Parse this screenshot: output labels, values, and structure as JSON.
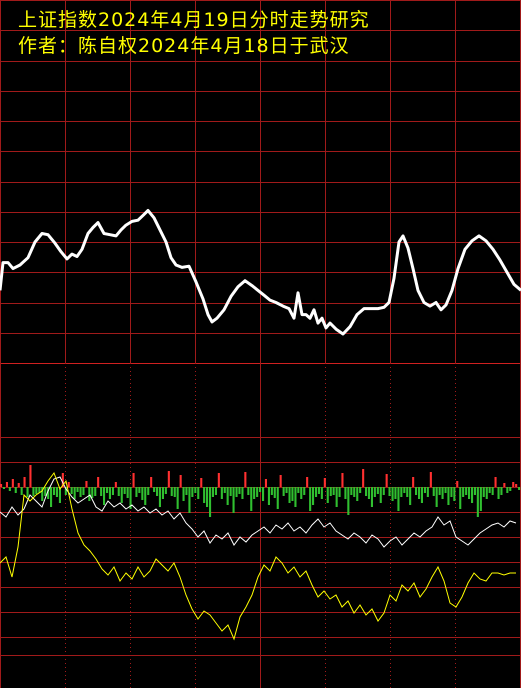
{
  "header": {
    "title": "上证指数2024年4月19日分时走势研究",
    "author": "作者：陈自权2024年4月18日于武汉"
  },
  "colors": {
    "background": "#000000",
    "grid": "#a01a1a",
    "title": "#ffff00",
    "price_line": "#ffffff",
    "bar_up": "#ff3030",
    "bar_down": "#30c030",
    "white_line": "#ffffff",
    "yellow_line": "#ffff00"
  },
  "chart_data": [
    {
      "type": "line",
      "panel": "upper",
      "grid": true,
      "x": [
        0,
        3,
        8,
        13,
        20,
        28,
        35,
        42,
        48,
        55,
        61,
        67,
        72,
        77,
        82,
        88,
        93,
        98,
        104,
        110,
        116,
        121,
        126,
        132,
        138,
        143,
        148,
        154,
        160,
        166,
        171,
        176,
        182,
        189,
        196,
        203,
        208,
        212,
        217,
        224,
        231,
        238,
        245,
        252,
        258,
        264,
        270,
        276,
        283,
        289,
        294,
        298,
        302,
        306,
        310,
        314,
        318,
        322,
        326,
        330,
        336,
        343,
        350,
        357,
        364,
        371,
        378,
        384,
        389,
        394,
        399,
        403,
        408,
        413,
        418,
        424,
        430,
        436,
        441,
        446,
        452,
        458,
        465,
        472,
        479,
        486,
        493,
        500,
        507,
        514,
        521
      ],
      "y": [
        0.1,
        0.33,
        0.33,
        0.28,
        0.31,
        0.37,
        0.5,
        0.57,
        0.56,
        0.49,
        0.42,
        0.36,
        0.4,
        0.38,
        0.44,
        0.57,
        0.62,
        0.66,
        0.57,
        0.56,
        0.55,
        0.6,
        0.64,
        0.67,
        0.68,
        0.72,
        0.76,
        0.7,
        0.6,
        0.5,
        0.37,
        0.31,
        0.29,
        0.3,
        0.17,
        0.03,
        -0.1,
        -0.16,
        -0.13,
        -0.06,
        0.05,
        0.13,
        0.18,
        0.14,
        0.1,
        0.06,
        0.02,
        0.0,
        -0.03,
        -0.05,
        -0.13,
        0.08,
        -0.1,
        -0.1,
        -0.13,
        -0.06,
        -0.17,
        -0.13,
        -0.21,
        -0.17,
        -0.22,
        -0.26,
        -0.2,
        -0.1,
        -0.05,
        -0.05,
        -0.05,
        -0.04,
        0.0,
        0.2,
        0.5,
        0.55,
        0.45,
        0.28,
        0.1,
        0.0,
        -0.03,
        0.0,
        -0.06,
        -0.02,
        0.1,
        0.28,
        0.44,
        0.51,
        0.55,
        0.51,
        0.44,
        0.35,
        0.25,
        0.15,
        0.1
      ],
      "ylim": [
        -0.5,
        2.5
      ]
    },
    {
      "type": "bar",
      "panel": "lower",
      "bars": [
        3,
        -2,
        5,
        -4,
        8,
        -6,
        4,
        -8,
        10,
        -10,
        22,
        -9,
        -7,
        -6,
        -14,
        -9,
        -12,
        -20,
        -8,
        -10,
        -16,
        14,
        -8,
        5,
        -7,
        -12,
        -5,
        -10,
        -8,
        6,
        -14,
        -11,
        -9,
        10,
        -9,
        -18,
        -6,
        -12,
        -8,
        5,
        -9,
        -16,
        -7,
        -11,
        -22,
        14,
        -10,
        -6,
        -13,
        -18,
        -8,
        10,
        -5,
        -9,
        -20,
        -12,
        -7,
        16,
        -9,
        -10,
        -22,
        12,
        -14,
        -8,
        -26,
        -10,
        -6,
        -12,
        9,
        -16,
        -20,
        -30,
        -10,
        -8,
        14,
        -12,
        -6,
        -18,
        -9,
        -26,
        -10,
        -7,
        -12,
        15,
        -8,
        -24,
        -12,
        -10,
        -5,
        -14,
        8,
        -18,
        -8,
        -11,
        -22,
        12,
        -9,
        -6,
        -16,
        -14,
        -20,
        -6,
        -12,
        -8,
        10,
        -24,
        -18,
        -10,
        -7,
        -12,
        9,
        -16,
        -9,
        -8,
        -20,
        -10,
        14,
        -12,
        -28,
        -8,
        -10,
        -14,
        -6,
        18,
        -9,
        -12,
        -20,
        -10,
        -7,
        -16,
        -8,
        13,
        -9,
        -14,
        -12,
        -24,
        -10,
        -6,
        -10,
        -18,
        10,
        -8,
        -12,
        -16,
        -6,
        -10,
        15,
        -9,
        -20,
        -8,
        -12,
        -6,
        -18,
        -10,
        -14,
        6,
        -22,
        -10,
        -8,
        -12,
        -16,
        -8,
        -30,
        -24,
        -10,
        -12,
        -6,
        -8,
        10,
        -12,
        -8,
        4,
        -6,
        -4,
        5,
        3,
        -3
      ],
      "ylim": [
        -40,
        30
      ]
    },
    {
      "type": "line",
      "panel": "lower",
      "series": [
        {
          "color": "white",
          "x": [
            0,
            6,
            12,
            18,
            24,
            30,
            36,
            42,
            48,
            54,
            60,
            66,
            72,
            78,
            84,
            90,
            96,
            102,
            108,
            114,
            120,
            126,
            132,
            138,
            144,
            150,
            156,
            162,
            168,
            174,
            180,
            186,
            192,
            198,
            204,
            210,
            216,
            222,
            228,
            234,
            240,
            246,
            252,
            258,
            264,
            270,
            276,
            282,
            288,
            294,
            300,
            306,
            312,
            318,
            324,
            330,
            336,
            342,
            348,
            354,
            360,
            366,
            372,
            378,
            384,
            390,
            396,
            402,
            408,
            414,
            420,
            426,
            432,
            438,
            444,
            450,
            456,
            462,
            468,
            474,
            480,
            486,
            492,
            498,
            504,
            510,
            516
          ],
          "y": [
            -25,
            -30,
            -20,
            -28,
            -22,
            -8,
            -14,
            -20,
            -4,
            8,
            10,
            -2,
            -10,
            -16,
            -12,
            -8,
            -20,
            -24,
            -14,
            -20,
            -16,
            -22,
            -18,
            -24,
            -20,
            -26,
            -22,
            -28,
            -24,
            -32,
            -26,
            -36,
            -42,
            -50,
            -44,
            -56,
            -48,
            -52,
            -46,
            -58,
            -50,
            -55,
            -48,
            -44,
            -40,
            -46,
            -38,
            -42,
            -36,
            -44,
            -40,
            -46,
            -38,
            -32,
            -40,
            -36,
            -44,
            -48,
            -52,
            -46,
            -50,
            -56,
            -48,
            -52,
            -60,
            -54,
            -50,
            -58,
            -52,
            -46,
            -50,
            -44,
            -40,
            -30,
            -38,
            -34,
            -50,
            -54,
            -58,
            -52,
            -46,
            -42,
            -38,
            -36,
            -40,
            -34,
            -36
          ]
        },
        {
          "color": "yellow",
          "x": [
            0,
            6,
            12,
            18,
            24,
            30,
            36,
            42,
            48,
            54,
            60,
            66,
            72,
            78,
            84,
            90,
            96,
            102,
            108,
            114,
            120,
            126,
            132,
            138,
            144,
            150,
            156,
            162,
            168,
            174,
            180,
            186,
            192,
            198,
            204,
            210,
            216,
            222,
            228,
            234,
            240,
            246,
            252,
            258,
            264,
            270,
            276,
            282,
            288,
            294,
            300,
            306,
            312,
            318,
            324,
            330,
            336,
            342,
            348,
            354,
            360,
            366,
            372,
            378,
            384,
            390,
            396,
            402,
            408,
            414,
            420,
            426,
            432,
            438,
            444,
            450,
            456,
            462,
            468,
            474,
            480,
            486,
            492,
            498,
            504,
            510,
            516
          ],
          "y": [
            -76,
            -70,
            -90,
            -60,
            -8,
            -14,
            -8,
            -4,
            6,
            14,
            -2,
            6,
            -22,
            -46,
            -58,
            -64,
            -72,
            -82,
            -88,
            -80,
            -94,
            -86,
            -92,
            -80,
            -90,
            -84,
            -72,
            -78,
            -84,
            -76,
            -90,
            -108,
            -122,
            -132,
            -124,
            -128,
            -136,
            -144,
            -138,
            -152,
            -130,
            -120,
            -108,
            -90,
            -78,
            -84,
            -70,
            -76,
            -86,
            -80,
            -90,
            -84,
            -98,
            -110,
            -104,
            -112,
            -108,
            -120,
            -114,
            -126,
            -118,
            -128,
            -122,
            -134,
            -126,
            -108,
            -114,
            -98,
            -104,
            -96,
            -110,
            -102,
            -90,
            -80,
            -94,
            -116,
            -120,
            -110,
            -96,
            -86,
            -92,
            -94,
            -86,
            -86,
            -88,
            -86,
            -86
          ]
        }
      ],
      "ylim": [
        -150,
        30
      ]
    }
  ]
}
